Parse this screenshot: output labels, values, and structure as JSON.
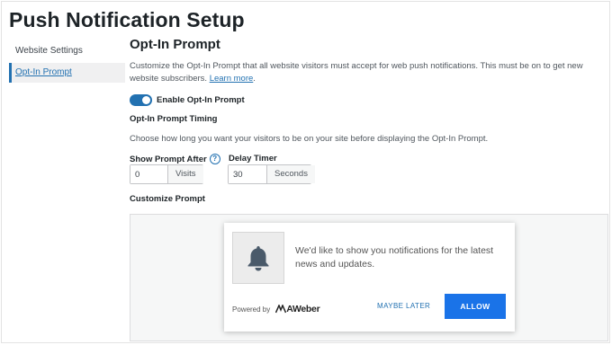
{
  "page": {
    "title": "Push Notification Setup"
  },
  "sidebar": {
    "items": [
      {
        "label": "Website Settings"
      },
      {
        "label": "Opt-In Prompt"
      }
    ]
  },
  "main": {
    "section_title": "Opt-In Prompt",
    "description": "Customize the Opt-In Prompt that all website visitors must accept for web push notifications. This must be on to get new website subscribers.",
    "learn_more": "Learn more",
    "toggle": {
      "label": "Enable Opt-In Prompt",
      "state": "on"
    },
    "timing": {
      "title": "Opt-In Prompt Timing",
      "description": "Choose how long you want your visitors to be on your site before displaying the Opt-In Prompt.",
      "show_after": {
        "label": "Show Prompt After",
        "value": "0",
        "unit": "Visits"
      },
      "delay": {
        "label": "Delay Timer",
        "value": "30",
        "unit": "Seconds"
      }
    },
    "customize_title": "Customize Prompt"
  },
  "preview": {
    "message": "We'd like to show you notifications for the latest news and updates.",
    "powered_by": "Powered by",
    "brand": "AWeber",
    "later_label": "MAYBE LATER",
    "allow_label": "ALLOW"
  },
  "colors": {
    "accent": "#2271b1",
    "allow_button": "#1a73e8",
    "bell": "#4a5a6a"
  }
}
